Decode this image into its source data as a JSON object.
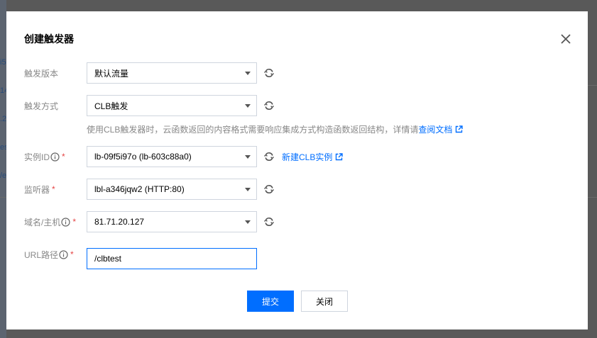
{
  "background": {
    "fragments": [
      "i5",
      "14",
      ".2",
      "es",
      "/e"
    ]
  },
  "modal": {
    "title": "创建触发器"
  },
  "form": {
    "trigger_version": {
      "label": "触发版本",
      "value": "默认流量"
    },
    "trigger_method": {
      "label": "触发方式",
      "value": "CLB触发"
    },
    "hint": {
      "text": "使用CLB触发器时，云函数返回的内容格式需要响应集成方式构造函数返回结构，详情请",
      "link": "查阅文档"
    },
    "instance_id": {
      "label": "实例ID",
      "required": "*",
      "value": "lb-09f5i97o (lb-603c88a0)",
      "new_link": "新建CLB实例"
    },
    "listener": {
      "label": "监听器",
      "required": "*",
      "value": "lbl-a346jqw2 (HTTP:80)"
    },
    "domain": {
      "label": "域名/主机",
      "required": "*",
      "value": "81.71.20.127"
    },
    "url_path": {
      "label": "URL路径",
      "required": "*",
      "value": "/clbtest"
    }
  },
  "buttons": {
    "submit": "提交",
    "close": "关闭"
  },
  "colors": {
    "primary": "#006eff",
    "required": "#e54545",
    "label": "#888888",
    "border": "#cfd5de"
  }
}
